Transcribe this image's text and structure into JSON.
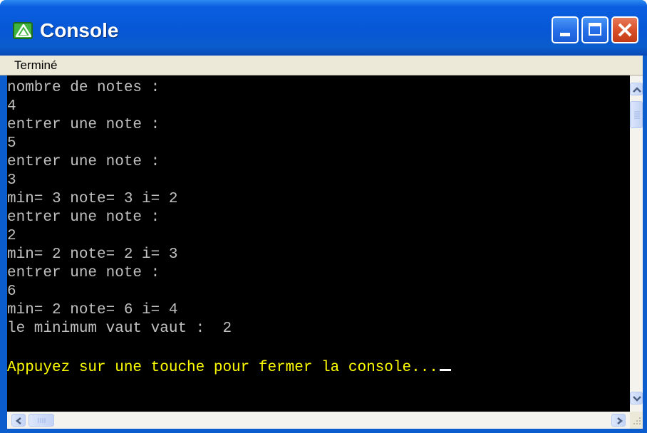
{
  "window": {
    "title": "Console",
    "icon": "console-app-icon",
    "controls": [
      "minimize-icon",
      "maximize-icon",
      "close-icon"
    ]
  },
  "statusbar": {
    "text": "Terminé"
  },
  "console": {
    "lines": [
      "nombre de notes :",
      "4",
      "entrer une note :",
      "5",
      "entrer une note :",
      "3",
      "min= 3 note= 3 i= 2",
      "entrer une note :",
      "2",
      "min= 2 note= 2 i= 3",
      "entrer une note :",
      "6",
      "min= 2 note= 6 i= 4",
      "le minimum vaut vaut :  2",
      "",
      "Appuyez sur une touche pour fermer la console..."
    ],
    "colors": {
      "background": "#000000",
      "text": "#c0c0c0",
      "prompt": "#ffff00"
    }
  }
}
